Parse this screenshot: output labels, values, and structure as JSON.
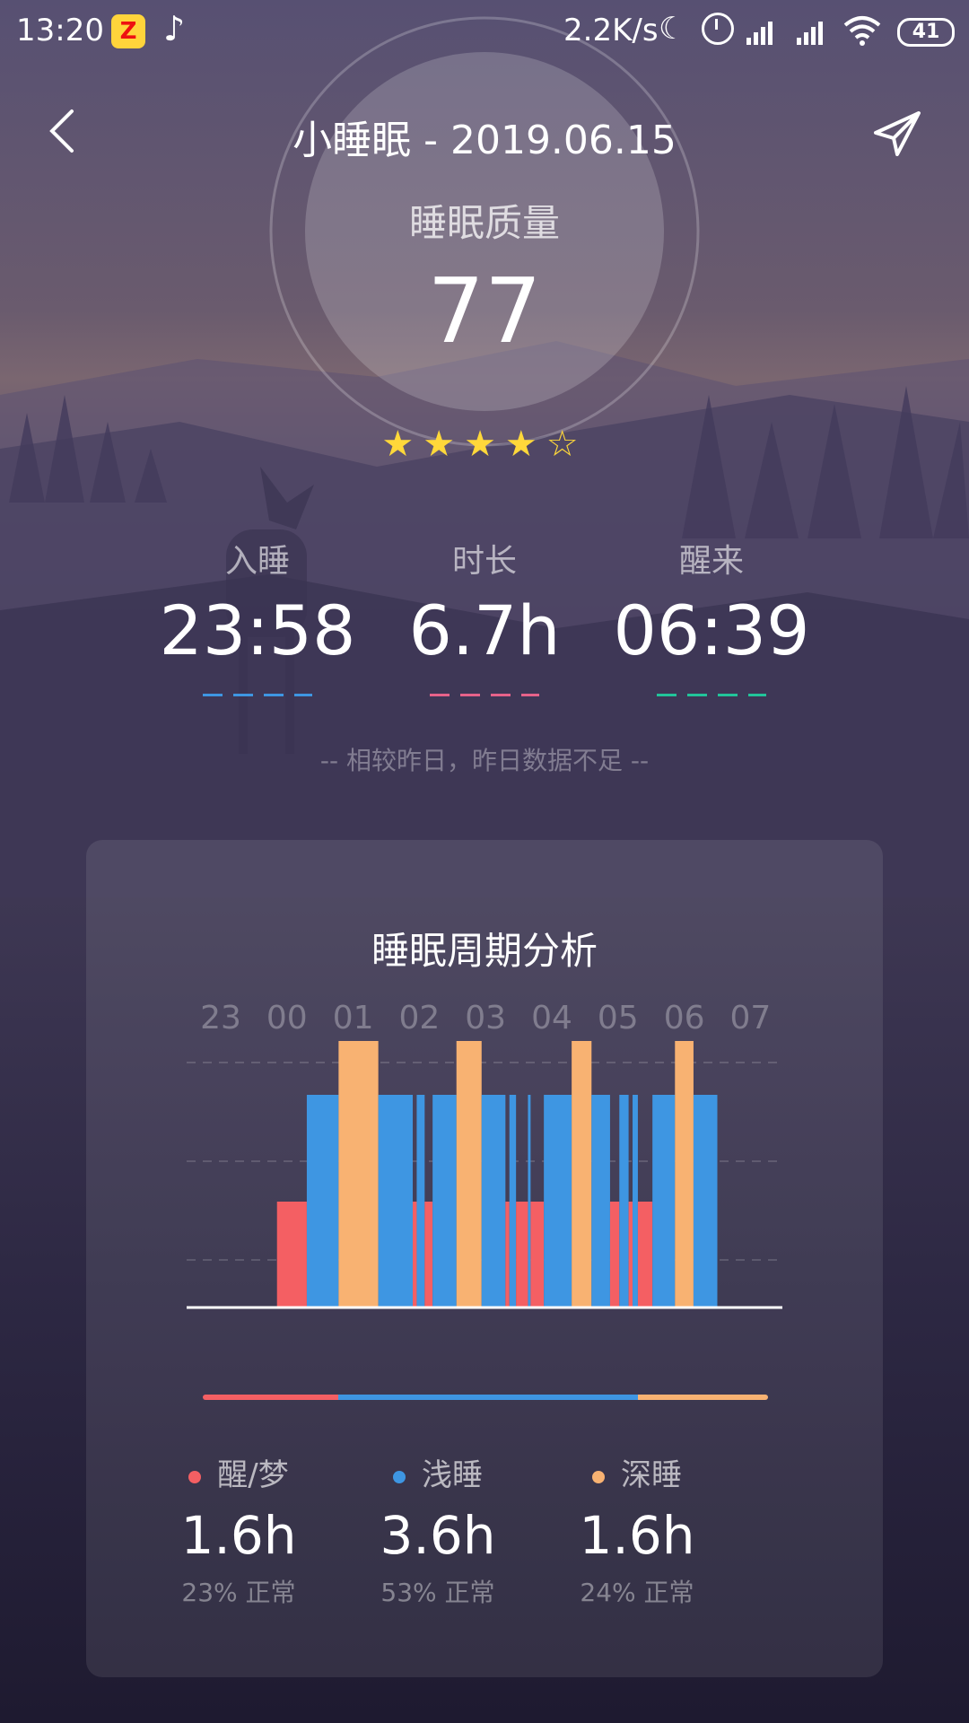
{
  "statusbar": {
    "time": "13:20",
    "net_speed": "2.2K/s",
    "battery": "41",
    "icons": [
      "qq-icon",
      "music-note-icon",
      "moon-icon",
      "alarm-icon",
      "signal-icon",
      "signal-icon",
      "wifi-icon",
      "battery-icon"
    ]
  },
  "header": {
    "title": "小睡眠 - 2019.06.15",
    "back_icon": "chevron-left-icon",
    "share_icon": "paper-plane-icon"
  },
  "quality": {
    "label": "睡眠质量",
    "score": "77",
    "stars_filled": 4,
    "stars_total": 5
  },
  "metrics": [
    {
      "label": "入睡",
      "value": "23:58",
      "color": "#3e96e2"
    },
    {
      "label": "时长",
      "value": "6.7h",
      "color": "#e6628a"
    },
    {
      "label": "醒来",
      "value": "06:39",
      "color": "#22c49a"
    }
  ],
  "compare_note": "-- 相较昨日，昨日数据不足 --",
  "cycle": {
    "title": "睡眠周期分析",
    "legend": [
      {
        "label": "醒/梦",
        "value": "1.6h",
        "sub": "23% 正常",
        "color": "#f45f63"
      },
      {
        "label": "浅睡",
        "value": "3.6h",
        "sub": "53% 正常",
        "color": "#3e96e2"
      },
      {
        "label": "深睡",
        "value": "1.6h",
        "sub": "24% 正常",
        "color": "#f8b272"
      }
    ]
  },
  "chart_data": {
    "type": "bar",
    "hours": [
      "23",
      "00",
      "01",
      "02",
      "03",
      "04",
      "05",
      "06",
      "07"
    ],
    "levels": {
      "1": "醒/梦",
      "2": "浅睡",
      "3": "深睡"
    },
    "colors": {
      "1": "#f45f63",
      "2": "#3e96e2",
      "3": "#f8b272"
    },
    "segments": [
      {
        "start": 0.85,
        "end": 1.3,
        "level": 1
      },
      {
        "start": 1.3,
        "end": 1.78,
        "level": 2
      },
      {
        "start": 1.78,
        "end": 2.38,
        "level": 3
      },
      {
        "start": 2.38,
        "end": 2.9,
        "level": 2
      },
      {
        "start": 2.9,
        "end": 2.96,
        "level": 1
      },
      {
        "start": 2.96,
        "end": 3.08,
        "level": 2
      },
      {
        "start": 3.08,
        "end": 3.2,
        "level": 1
      },
      {
        "start": 3.2,
        "end": 3.56,
        "level": 2
      },
      {
        "start": 3.56,
        "end": 3.94,
        "level": 3
      },
      {
        "start": 3.94,
        "end": 4.3,
        "level": 2
      },
      {
        "start": 4.3,
        "end": 4.36,
        "level": 1
      },
      {
        "start": 4.36,
        "end": 4.46,
        "level": 2
      },
      {
        "start": 4.46,
        "end": 4.64,
        "level": 1
      },
      {
        "start": 4.64,
        "end": 4.68,
        "level": 2
      },
      {
        "start": 4.68,
        "end": 4.88,
        "level": 1
      },
      {
        "start": 4.88,
        "end": 5.3,
        "level": 2
      },
      {
        "start": 5.3,
        "end": 5.6,
        "level": 3
      },
      {
        "start": 5.6,
        "end": 5.88,
        "level": 2
      },
      {
        "start": 5.88,
        "end": 6.02,
        "level": 1
      },
      {
        "start": 6.02,
        "end": 6.16,
        "level": 2
      },
      {
        "start": 6.16,
        "end": 6.22,
        "level": 1
      },
      {
        "start": 6.22,
        "end": 6.3,
        "level": 2
      },
      {
        "start": 6.3,
        "end": 6.52,
        "level": 1
      },
      {
        "start": 6.52,
        "end": 6.86,
        "level": 2
      },
      {
        "start": 6.86,
        "end": 7.14,
        "level": 3
      },
      {
        "start": 7.14,
        "end": 7.5,
        "level": 2
      }
    ]
  }
}
